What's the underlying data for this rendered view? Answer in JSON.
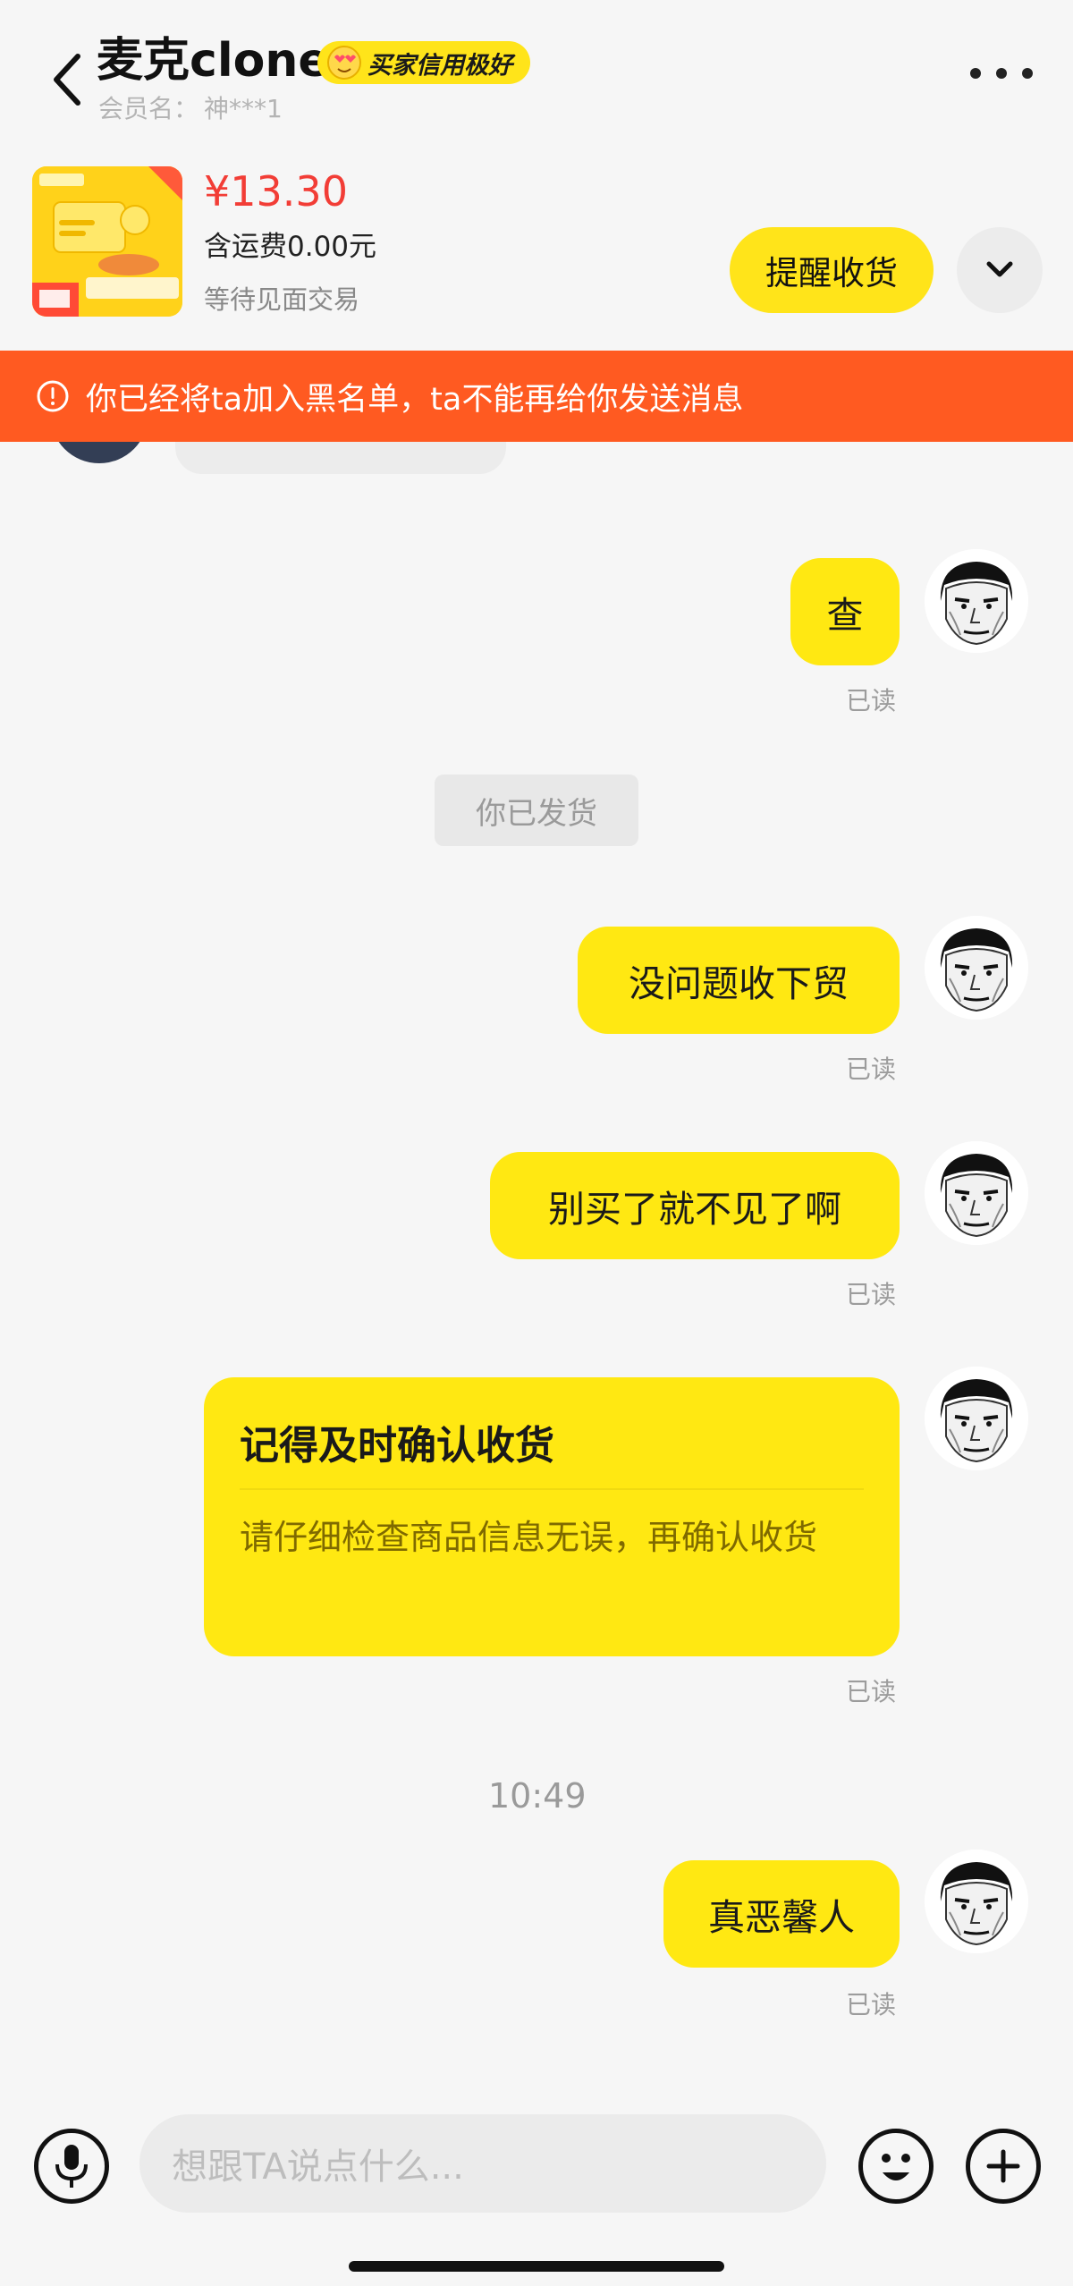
{
  "header": {
    "title": "麦克clone",
    "credit_badge": "买家信用极好",
    "member_label": "会员名：",
    "member_value": "神***1"
  },
  "product": {
    "price": "¥13.30",
    "shipping": "含运费0.00元",
    "status": "等待见面交易",
    "remind_button": "提醒收货"
  },
  "warning": {
    "text": "你已经将ta加入黑名单，ta不能再给你发送消息"
  },
  "messages": {
    "m1": {
      "text": "查",
      "status": "已读"
    },
    "system1": "你已发货",
    "m2": {
      "text": "没问题收下贸",
      "status": "已读"
    },
    "m3": {
      "text": "别买了就不见了啊",
      "status": "已读"
    },
    "card": {
      "title": "记得及时确认收货",
      "body": "请仔细检查商品信息无误，再确认收货",
      "status": "已读"
    },
    "time": "10:49",
    "m4": {
      "text": "真恶馨人",
      "status": "已读"
    }
  },
  "input": {
    "placeholder": "想跟TA说点什么..."
  },
  "colors": {
    "accent_yellow": "#ffe812",
    "warning_orange": "#ff5a21",
    "price_red": "#f23d36"
  },
  "icons": [
    "back-arrow-icon",
    "more-icon",
    "chevron-down-icon",
    "warning-icon",
    "mic-icon",
    "emoji-icon",
    "plus-icon"
  ]
}
